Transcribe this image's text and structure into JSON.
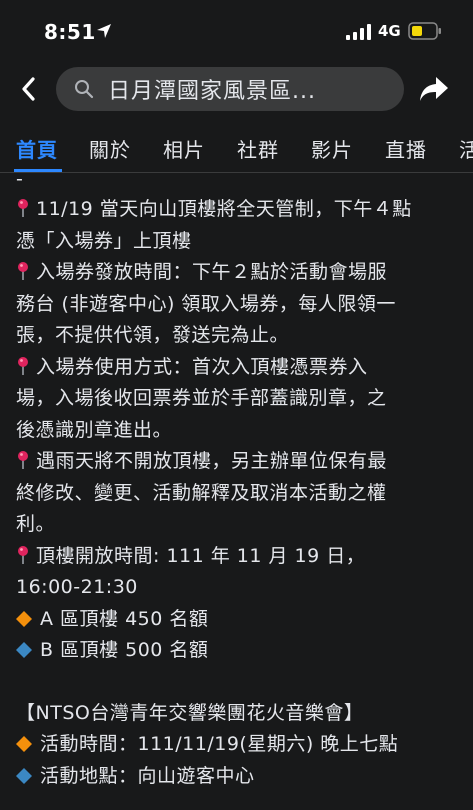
{
  "status_bar": {
    "time": "8:51",
    "network": "4G"
  },
  "nav": {
    "search_title": "日月潭國家風景區..."
  },
  "tabs": [
    {
      "label": "首頁"
    },
    {
      "label": "關於"
    },
    {
      "label": "相片"
    },
    {
      "label": "社群"
    },
    {
      "label": "影片"
    },
    {
      "label": "直播"
    },
    {
      "label": "活"
    }
  ],
  "post": {
    "dash": "-",
    "lines": [
      "11/19 當天向山頂樓將全天管制，下午４點",
      "憑「入場券」上頂樓",
      "入場券發放時間：下午２點於活動會場服",
      "務台 (非遊客中心) 領取入場券，每人限領一",
      "張，不提供代領，發送完為止。",
      "入場券使用方式：首次入頂樓憑票券入",
      "場，入場後收回票券並於手部蓋識別章，之",
      "後憑識別章進出。",
      "遇雨天將不開放頂樓，另主辦單位保有最",
      "終修改、變更、活動解釋及取消本活動之權",
      "利。",
      "頂樓開放時間: 111 年 11 月 19 日，",
      "16:00-21:30",
      "A 區頂樓 450 名額",
      "B 區頂樓 500 名額",
      "【NTSO台灣青年交響樂團花火音樂會】",
      "活動時間：111/11/19(星期六) 晚上七點",
      "活動地點：向山遊客中心"
    ]
  },
  "colors": {
    "background": "#18191a",
    "accent": "#2d88ff",
    "pin": "#e0245e",
    "orange_diamond": "#f4900c",
    "blue_diamond": "#3b88c3"
  }
}
